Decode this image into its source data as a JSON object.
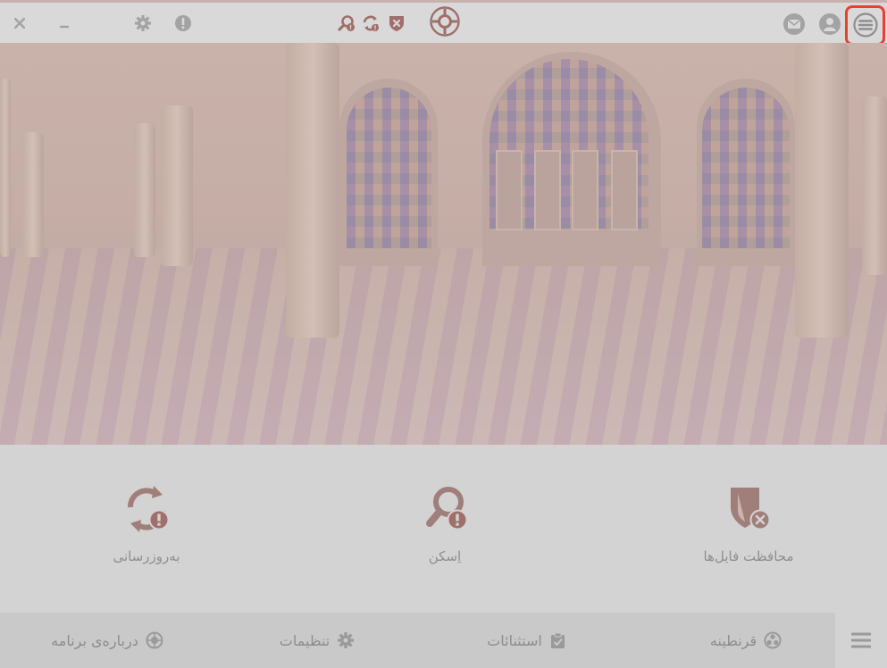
{
  "features": {
    "file_protection": "محافظت فایل‌ها",
    "scan": "اِسکن",
    "update": "به‌روزرسانی"
  },
  "nav": {
    "quarantine": "قرنطینه",
    "exceptions": "استثنائات",
    "settings": "تنظیمات",
    "about": "درباره‌ی برنامه"
  },
  "icons": {
    "close": "close-icon",
    "minimize": "minimize-icon",
    "settings": "gear-icon",
    "alert": "exclamation-icon",
    "scan_alert": "search-alert-icon",
    "update_alert": "refresh-alert-icon",
    "shield": "shield-x-icon",
    "target": "crosshair-icon",
    "mail": "mail-icon",
    "user": "user-icon",
    "menu": "hamburger-menu-icon"
  },
  "colors": {
    "highlight": "#e8402f",
    "feature_icon": "#a07f7a",
    "badge": "#9e6f6b",
    "muted_icon": "#9d9d9d"
  }
}
